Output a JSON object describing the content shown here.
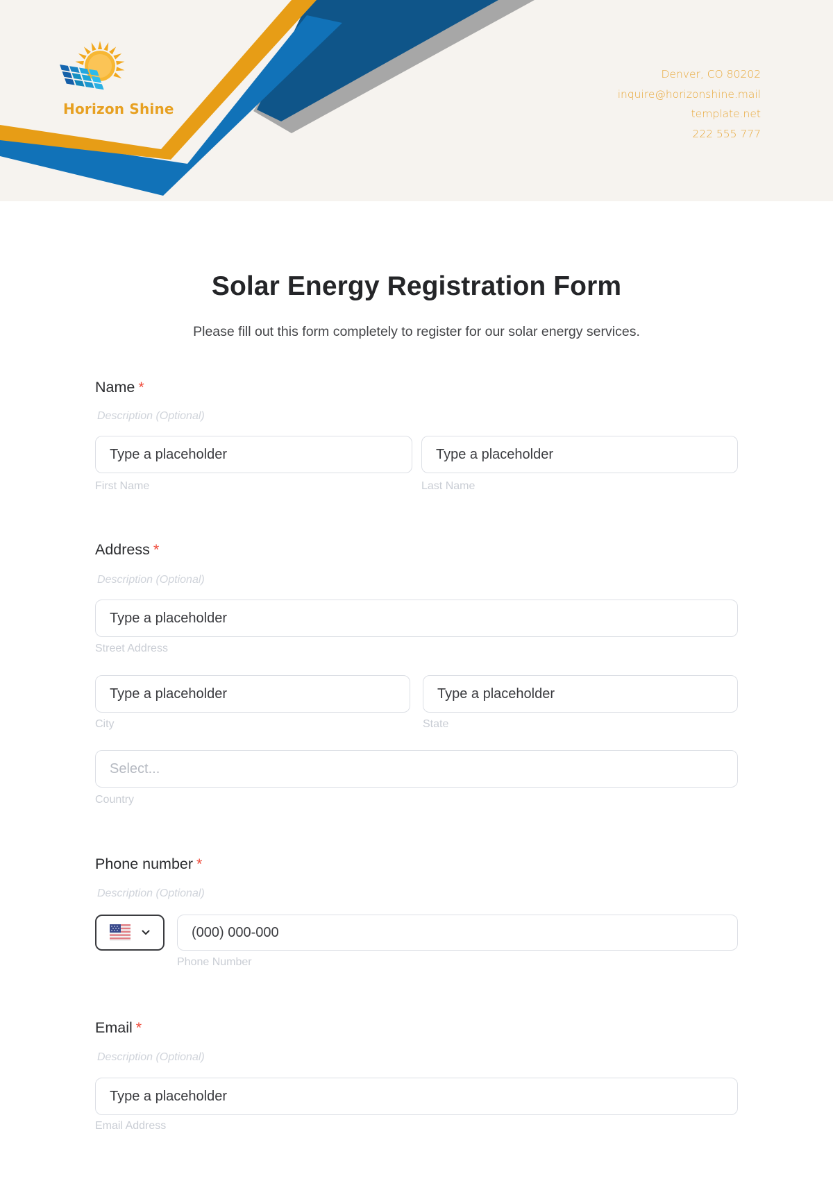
{
  "header": {
    "company_name": "Horizon Shine",
    "contact": {
      "address": "Denver, CO 80202",
      "email": "inquire@horizonshine.mail",
      "website": "template.net",
      "phone": "222 555 777"
    },
    "colors": {
      "orange": "#e79d16",
      "blue": "#1172b8",
      "navy": "#0f5589",
      "gray": "#a7a7a7",
      "background": "#f6f3ef"
    }
  },
  "form": {
    "title": "Solar Energy Registration Form",
    "subtitle": "Please fill out this form completely to register for our solar energy services.",
    "required_marker": "*",
    "fields": {
      "name": {
        "label": "Name",
        "description": "Description (Optional)",
        "first": {
          "placeholder": "Type a placeholder",
          "sublabel": "First Name"
        },
        "last": {
          "placeholder": "Type a placeholder",
          "sublabel": "Last Name"
        }
      },
      "address": {
        "label": "Address",
        "description": "Description (Optional)",
        "street": {
          "placeholder": "Type a placeholder",
          "sublabel": "Street Address"
        },
        "city": {
          "placeholder": "Type a placeholder",
          "sublabel": "City"
        },
        "state": {
          "placeholder": "Type a placeholder",
          "sublabel": "State"
        },
        "country": {
          "placeholder": "Select...",
          "sublabel": "Country"
        }
      },
      "phone": {
        "label": "Phone number",
        "description": "Description (Optional)",
        "country_code_icon": "us-flag-icon",
        "placeholder": "(000) 000-000",
        "sublabel": "Phone Number"
      },
      "email": {
        "label": "Email",
        "description": "Description (Optional)",
        "placeholder": "Type a placeholder",
        "sublabel": "Email Address"
      }
    }
  }
}
